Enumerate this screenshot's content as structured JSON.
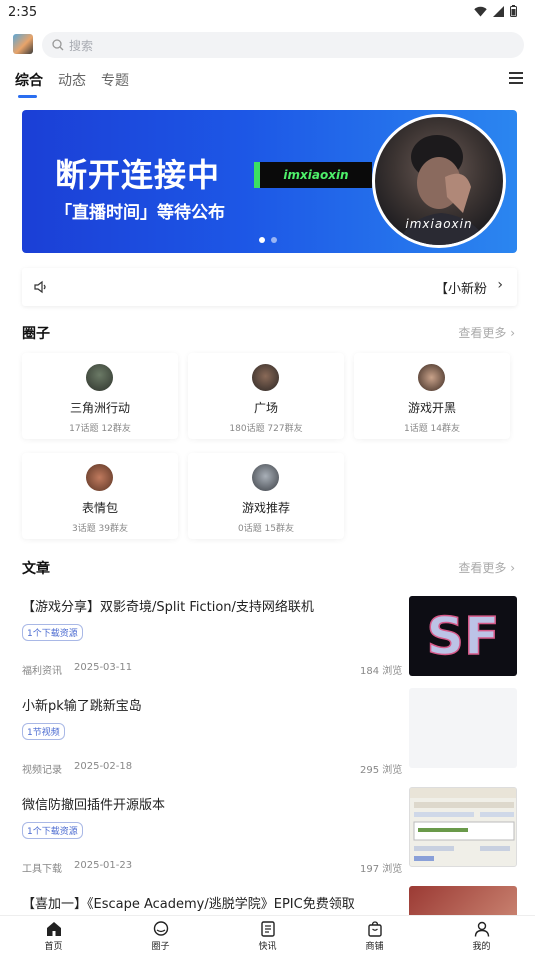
{
  "status": {
    "time": "2:35"
  },
  "search": {
    "placeholder": "搜索"
  },
  "tabs": [
    {
      "label": "综合",
      "active": true
    },
    {
      "label": "动态",
      "active": false
    },
    {
      "label": "专题",
      "active": false
    }
  ],
  "banner": {
    "title": "断开连接中",
    "tag": "imxiaoxin",
    "subtitle": "「直播时间」等待公布",
    "photo_caption": "imxiaoxin",
    "dots": 2,
    "active_dot": 0
  },
  "notice": {
    "text": "【小新粉",
    "arrow": "›"
  },
  "circles": {
    "title": "圈子",
    "more": "查看更多 ›",
    "items": [
      {
        "name": "三角洲行动",
        "stats": "17话题 12群友"
      },
      {
        "name": "广场",
        "stats": "180话题 727群友"
      },
      {
        "name": "游戏开黑",
        "stats": "1话题 14群友"
      },
      {
        "name": "表情包",
        "stats": "3话题 39群友"
      },
      {
        "name": "游戏推荐",
        "stats": "0话题 15群友"
      }
    ]
  },
  "articles": {
    "title": "文章",
    "more": "查看更多 ›",
    "items": [
      {
        "title": "【游戏分享】双影奇境/Split Fiction/支持网络联机",
        "badge": "1个下载资源",
        "category": "福利资讯",
        "date": "2025-03-11",
        "views": "184 浏览"
      },
      {
        "title": "小新pk输了跳新宝岛",
        "badge": "1节视频",
        "category": "视频记录",
        "date": "2025-02-18",
        "views": "295 浏览"
      },
      {
        "title": "微信防撤回插件开源版本",
        "badge": "1个下载资源",
        "category": "工具下载",
        "date": "2025-01-23",
        "views": "197 浏览"
      },
      {
        "title": "【喜加一】《Escape Academy/逃脱学院》EPIC免费领取",
        "badge": "",
        "category": "",
        "date": "",
        "views": ""
      }
    ]
  },
  "bottom_nav": [
    {
      "label": "首页",
      "icon": "home-icon",
      "active": true
    },
    {
      "label": "圈子",
      "icon": "chat-bubble-icon",
      "active": false
    },
    {
      "label": "快讯",
      "icon": "news-icon",
      "active": false
    },
    {
      "label": "商铺",
      "icon": "shop-bag-icon",
      "active": false
    },
    {
      "label": "我的",
      "icon": "user-icon",
      "active": false
    }
  ]
}
